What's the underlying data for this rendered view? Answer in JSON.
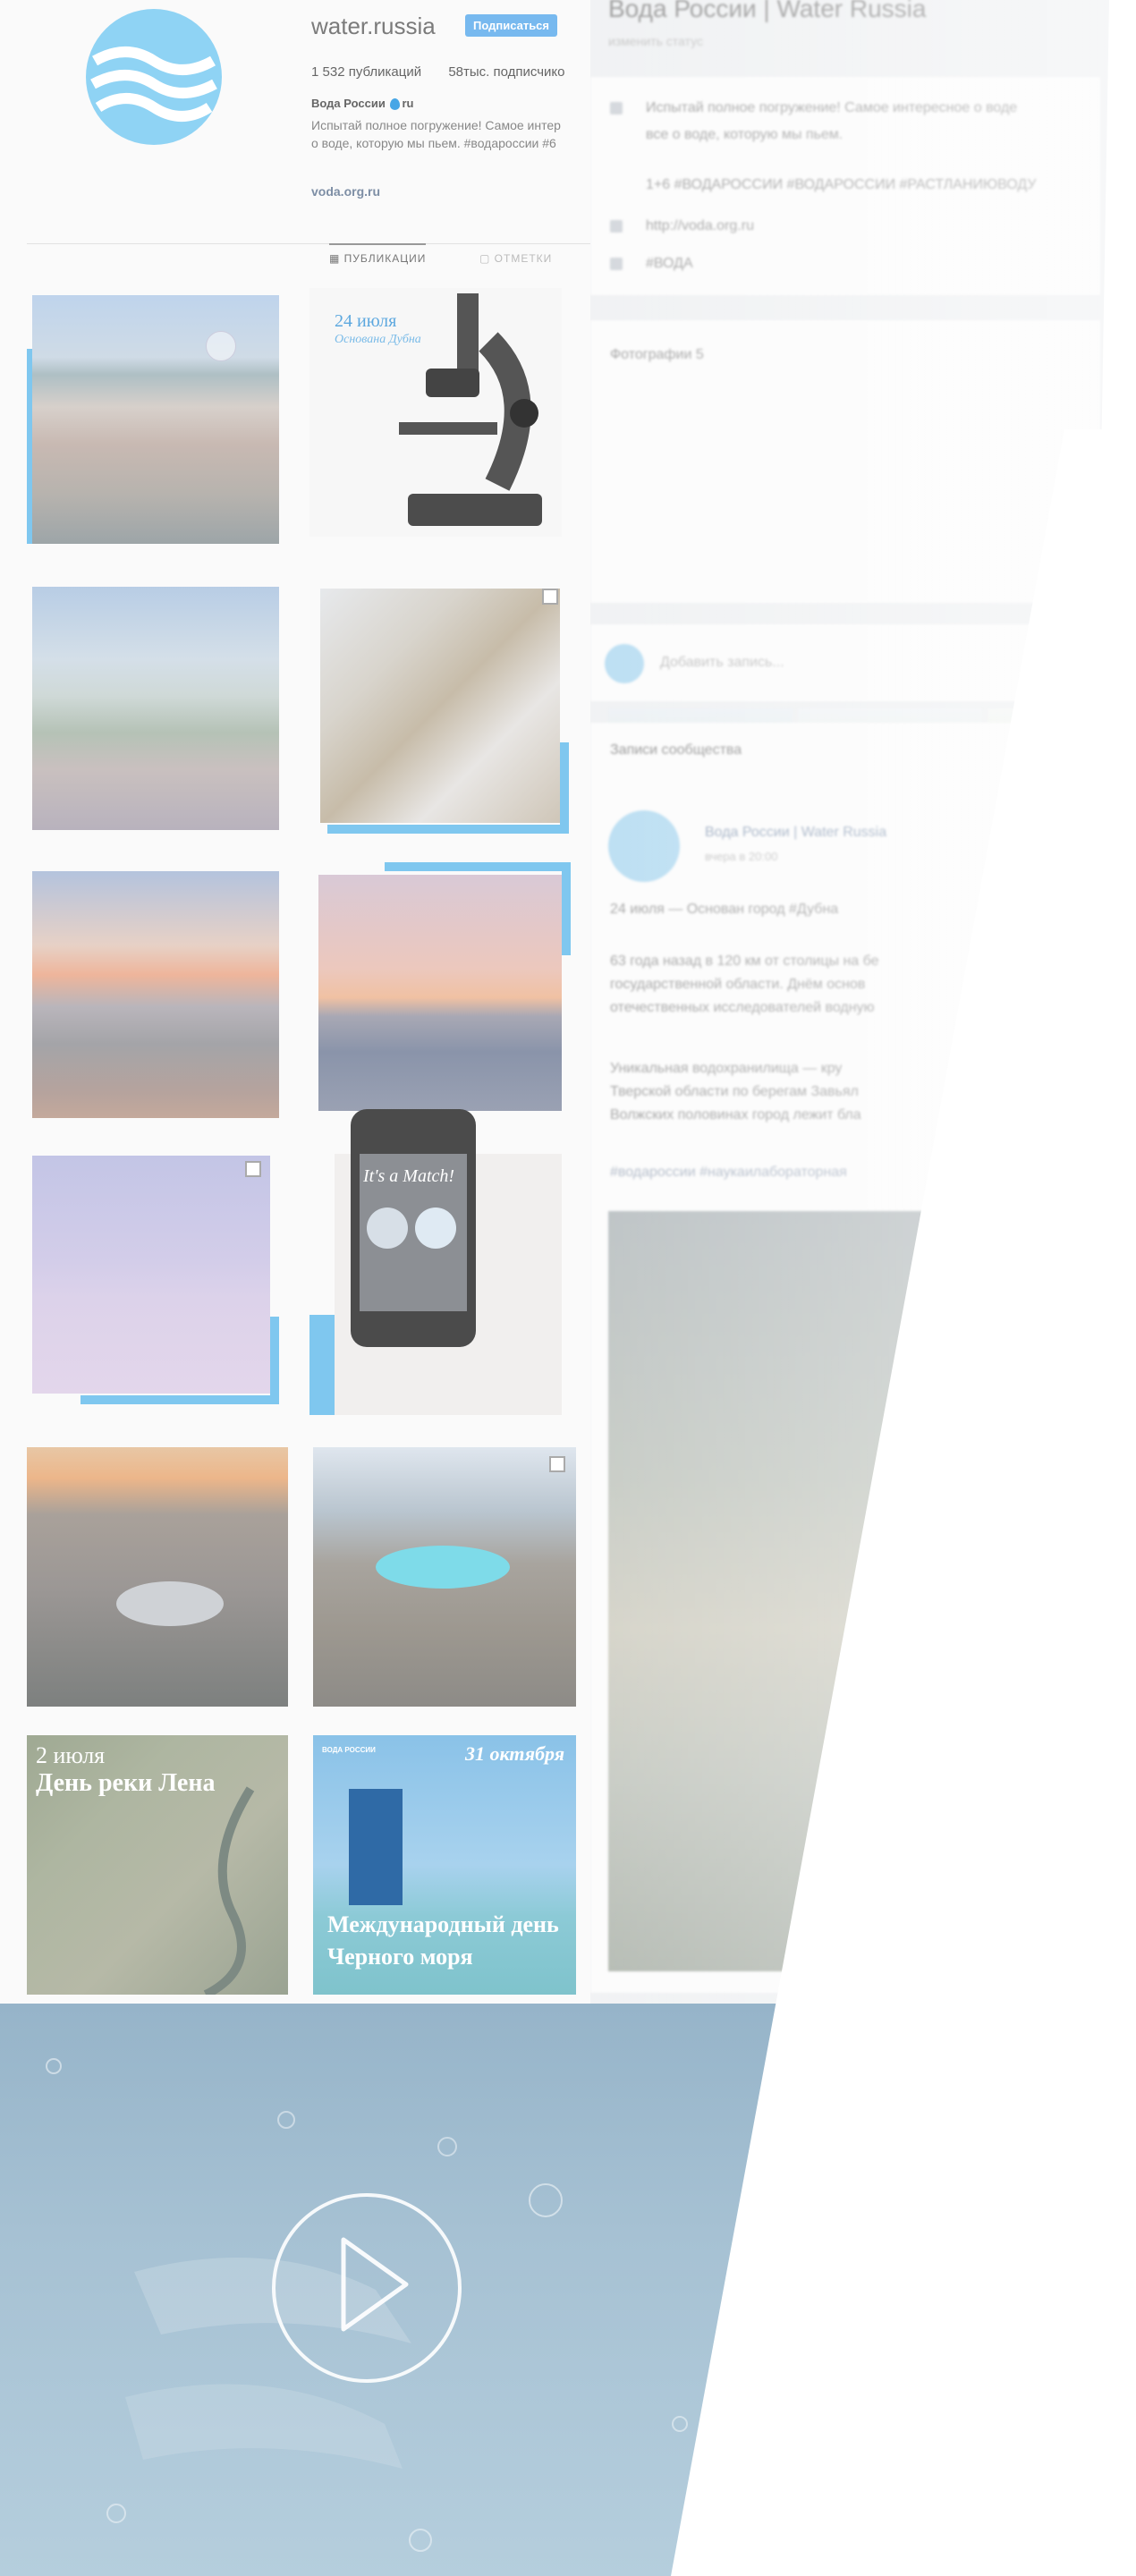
{
  "instagram": {
    "username": "water.russia",
    "follow_label": "Подписаться",
    "posts_count": "1 532 публикаций",
    "followers_count": "58тыс. подписчико",
    "full_name_part1": "Вода России",
    "full_name_part2": "ru",
    "bio_line1": "Испытай полное погружение! Самое интер",
    "bio_line2": "о воде, которую мы пьем. #водароссии #6",
    "website": "voda.org.ru",
    "tabs": [
      "ПУБЛИКАЦИИ",
      "ОТМЕТКИ"
    ],
    "tiles": [
      {
        "caption1": "",
        "caption2": ""
      },
      {
        "caption1": "24 июля",
        "caption2": "Основана Дубна"
      },
      {
        "caption1": "",
        "caption2": ""
      },
      {
        "caption1": "",
        "caption2": ""
      },
      {
        "caption1": "",
        "caption2": ""
      },
      {
        "caption1": "",
        "caption2": ""
      },
      {
        "caption1": "",
        "caption2": ""
      },
      {
        "caption1": "It's a Match!",
        "caption2": ""
      },
      {
        "caption1": "",
        "caption2": ""
      },
      {
        "caption1": "",
        "caption2": ""
      },
      {
        "caption1": "2 июля",
        "caption2": "День реки Лена"
      },
      {
        "caption1": "31 октября",
        "caption2": "Международный день Черного моря",
        "brand": "ВОДА РОССИИ"
      }
    ],
    "colors": {
      "accent": "#7fc7ef",
      "follow": "#77b9ef"
    }
  },
  "vk": {
    "title": "Вода России | Water Russia",
    "subtitle": "изменить статус",
    "info_rows": [
      {
        "icon": "info-icon",
        "text": "Испытай полное погружение! Самое интересное о воде"
      },
      {
        "icon": "",
        "text": "все о воде, которую мы пьем."
      },
      {
        "icon": "",
        "text": "1+6   #ВОДАРОССИИ #ВОДАРОССИИ #РАСТЛАНИЮВОДУ"
      },
      {
        "icon": "link-icon",
        "text": "http://voda.org.ru"
      },
      {
        "icon": "phone-icon",
        "text": "#ВОДА"
      }
    ],
    "photos_heading": "Фотографии  5",
    "add_post_placeholder": "Добавить запись...",
    "wall_heading": "Записи сообщества",
    "post_author": "Вода России | Water Russia",
    "post_date": "вчера в 20:00",
    "post_title": "24 июля — Основан город #Дубна",
    "post_p1_line1": "63 года назад в 120 км от столицы на бе",
    "post_p1_line2": "государственной области. Днём основ",
    "post_p1_line3": "отечественных исследователей водную",
    "post_p2_line1": "Уникальная водохранилища — кру",
    "post_p2_line2": "Тверской области по берегам Завьял",
    "post_p2_line3": "Волжских половинах город лежит бла",
    "post_tags": "#водароссии #наукаилабораторная"
  }
}
